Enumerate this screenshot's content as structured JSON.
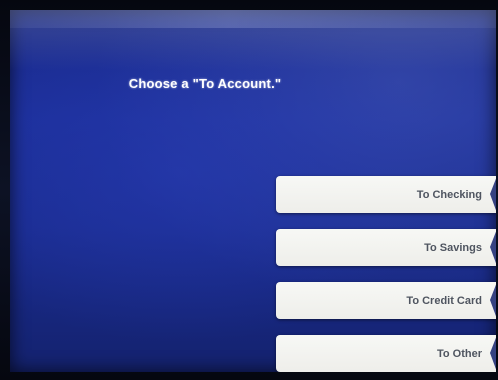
{
  "screen": {
    "prompt": "Choose a \"To Account.\""
  },
  "options": [
    {
      "label": "To Checking"
    },
    {
      "label": "To Savings"
    },
    {
      "label": "To Credit Card"
    },
    {
      "label": "To Other"
    }
  ],
  "colors": {
    "screen_blue": "#1c2f9a",
    "button_face": "#f2f3ef",
    "button_text": "#4f5560"
  }
}
